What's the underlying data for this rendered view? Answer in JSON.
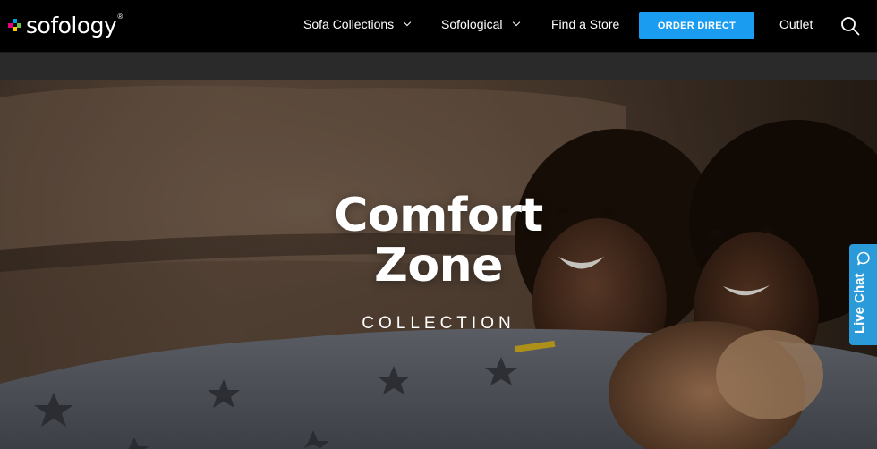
{
  "brand": {
    "logo_text": "sofology",
    "logo_mark": "®",
    "dot_colors": [
      "#e6007e",
      "#00a0e3",
      "#ffcc00",
      "#6cc24a"
    ]
  },
  "nav": {
    "items": [
      {
        "label": "Sofa Collections",
        "has_dropdown": true
      },
      {
        "label": "Sofological",
        "has_dropdown": true
      },
      {
        "label": "Find a Store",
        "has_dropdown": false
      }
    ],
    "order_button": "ORDER DIRECT",
    "outlet": "Outlet",
    "search_icon": "search-icon"
  },
  "hero": {
    "title_line1": "Comfort",
    "title_line2": "Zone",
    "subtitle": "COLLECTION"
  },
  "live_chat": {
    "label": "Live Chat",
    "icon": "chat-bubble-icon"
  },
  "colors": {
    "accent": "#1a9df0",
    "chat": "#2a9ad8",
    "header_bg": "#000000",
    "subbar_bg": "#2a2a2a"
  }
}
